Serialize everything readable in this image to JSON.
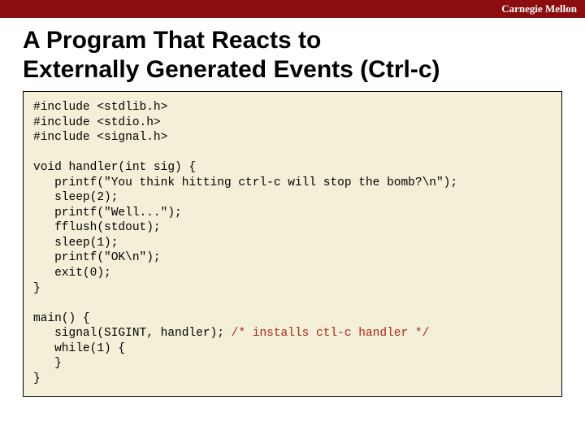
{
  "topbar": {
    "brand": "Carnegie Mellon"
  },
  "title": {
    "line1": "A Program That Reacts to",
    "line2": "Externally Generated Events (Ctrl-c)"
  },
  "code": {
    "l01": "#include <stdlib.h>",
    "l02": "#include <stdio.h>",
    "l03": "#include <signal.h>",
    "l04": "",
    "l05": "void handler(int sig) {",
    "l06": "   printf(\"You think hitting ctrl-c will stop the bomb?\\n\");",
    "l07": "   sleep(2);",
    "l08": "   printf(\"Well...\");",
    "l09": "   fflush(stdout);",
    "l10": "   sleep(1);",
    "l11": "   printf(\"OK\\n\");",
    "l12": "   exit(0);",
    "l13": "}",
    "l14": "",
    "l15": "main() {",
    "l16a": "   signal(SIGINT, handler); ",
    "l16b": "/* installs ctl-c handler */",
    "l17": "   while(1) {",
    "l18": "   }",
    "l19": "}"
  }
}
